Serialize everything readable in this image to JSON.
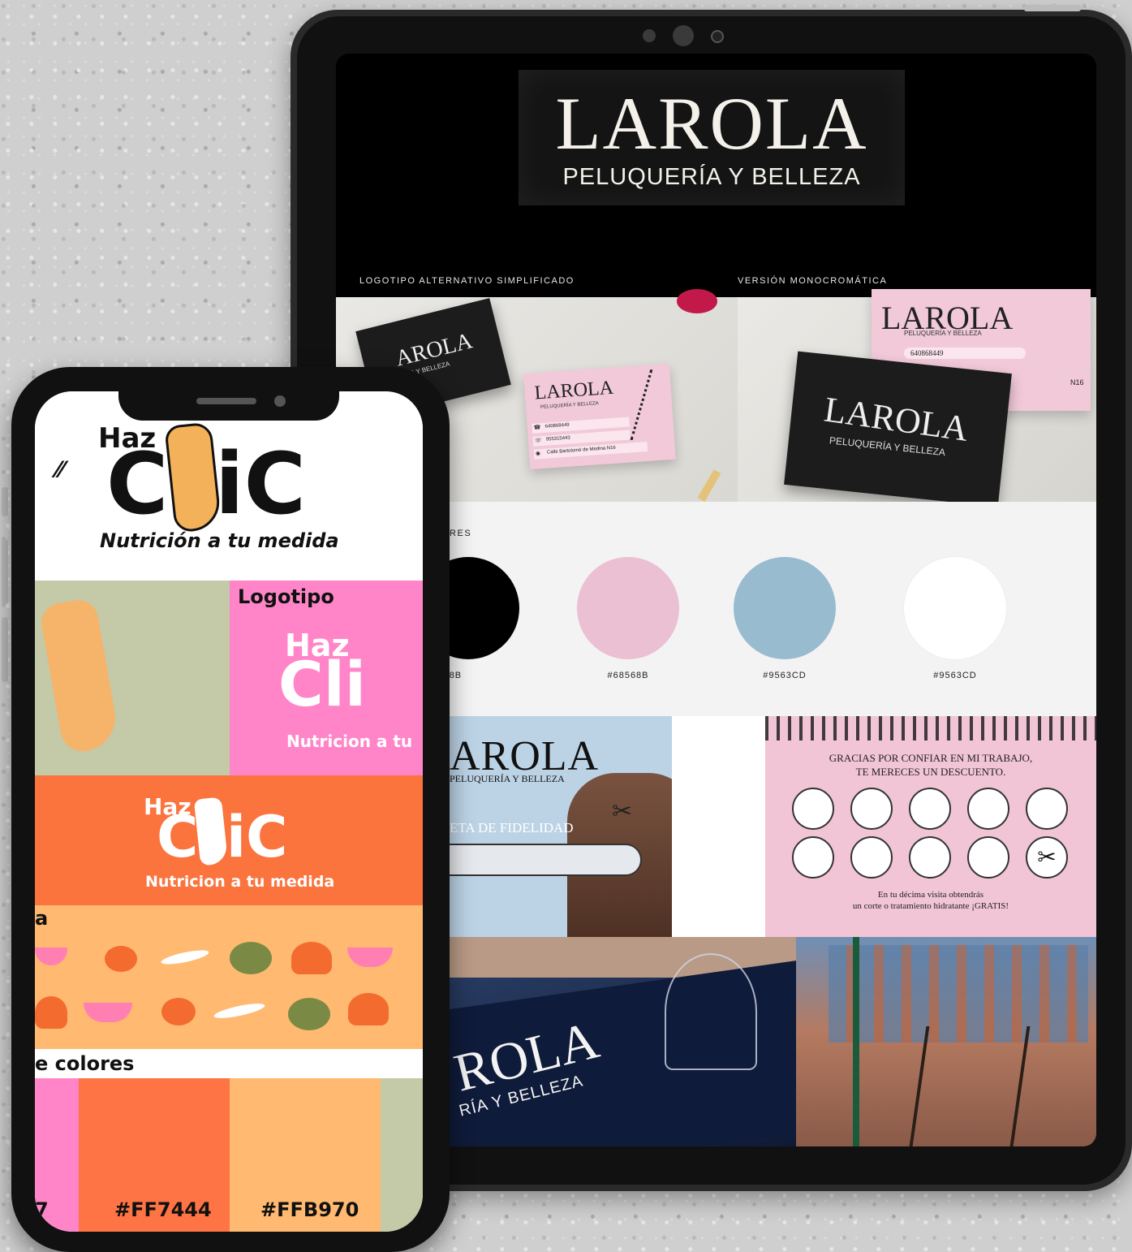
{
  "tablet": {
    "logo": {
      "title": "LAROLA",
      "subtitle": "PELUQUERÍA Y BELLEZA"
    },
    "section_labels": {
      "alt_logo": "LOGOTIPO ALTERNATIVO SIMPLIFICADO",
      "mono": "VERSIÓN MONOCROMÁTICA",
      "colors": "ORES"
    },
    "business_card": {
      "brand": "LAROLA",
      "tagline": "PELUQUERÍA Y BELLEZA",
      "phone1": "640868449",
      "phone2": "955315443",
      "address": "Calle Bartolomé de Medina N16"
    },
    "dark_card": {
      "brand": "AROLA",
      "tagline": "ERÍA Y BELLEZA"
    },
    "mono_card": {
      "brand": "LAROLA",
      "tagline": "PELUQUERÍA Y BELLEZA",
      "phone": "640868449",
      "partial": "N16"
    },
    "palette": [
      {
        "hex": "#401A8B",
        "display": "401A8B",
        "color": "#000000"
      },
      {
        "hex": "#68568B",
        "display": "#68568B",
        "color": "#EAC0D2"
      },
      {
        "hex": "#9563CD",
        "display": "#9563CD",
        "color": "#98BBD0"
      },
      {
        "hex": "#9563CD",
        "display": "#9563CD",
        "color": "#FFFFFF"
      }
    ],
    "fidelity_card": {
      "brand": "AROLA",
      "tagline": "PELUQUERÍA Y BELLEZA",
      "label": "ETA DE FIDELIDAD"
    },
    "loyalty_card": {
      "heading_line1": "GRACIAS POR CONFIAR EN MI TRABAJO,",
      "heading_line2": "TE MERECES UN DESCUENTO.",
      "footer_line1": "En tu décima visita obtendrás",
      "footer_line2": "un corte o tratamiento hidratante ¡GRATIS!"
    },
    "storefront": {
      "brand": "ROLA",
      "tagline": "RÍA Y BELLEZA"
    }
  },
  "phone": {
    "logo": {
      "word1": "Haz",
      "word2_a": "C",
      "word2_b": "iC",
      "tagline": "Nutrición a tu medida"
    },
    "logotipo_label": "Logotipo",
    "pink_logo": {
      "word1": "Haz",
      "word2": "Cli",
      "tagline": "Nutricion a tu"
    },
    "orange_logo": {
      "word1": "Haz",
      "word2_a": "C",
      "word2_b": "iC",
      "tagline": "Nutricion a tu medida"
    },
    "pattern_label": "a",
    "colors_label": "e colores",
    "swatches": [
      {
        "hex": "",
        "display": "7",
        "color": "#FF85C8"
      },
      {
        "hex": "#FF7444",
        "display": "#FF7444",
        "color": "#FF7444"
      },
      {
        "hex": "#FFB970",
        "display": "#FFB970",
        "color": "#FFB970"
      },
      {
        "hex": "",
        "display": "",
        "color": "#C4C9A7"
      }
    ]
  }
}
